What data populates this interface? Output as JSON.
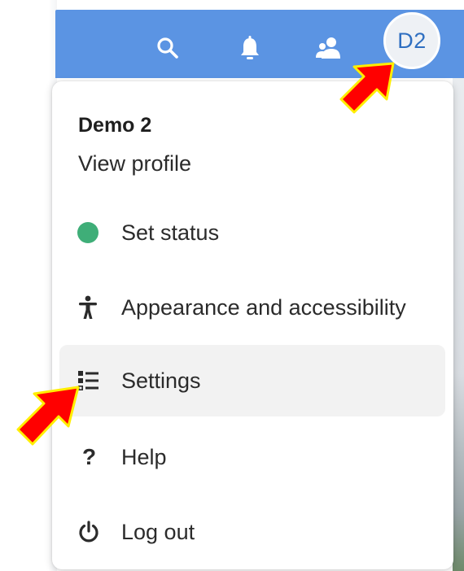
{
  "header": {
    "icons": [
      "search-icon",
      "bell-icon",
      "people-icon"
    ],
    "avatar_initials": "D2",
    "bar_color": "#5b94e3"
  },
  "menu": {
    "user_name": "Demo 2",
    "view_profile_label": "View profile",
    "items": [
      {
        "label": "Set status",
        "icon": "status-dot-icon",
        "status_color": "#3fae78"
      },
      {
        "label": "Appearance and accessibility",
        "icon": "accessibility-icon"
      },
      {
        "label": "Settings",
        "icon": "settings-list-icon",
        "highlighted": true
      },
      {
        "label": "Help",
        "icon": "help-icon",
        "glyph": "?"
      },
      {
        "label": "Log out",
        "icon": "power-icon"
      }
    ]
  },
  "annotations": {
    "arrow_color": "#ff0000",
    "arrow_outline": "#ffee00",
    "arrows": [
      "pointer-arrow-avatar",
      "pointer-arrow-settings"
    ]
  }
}
